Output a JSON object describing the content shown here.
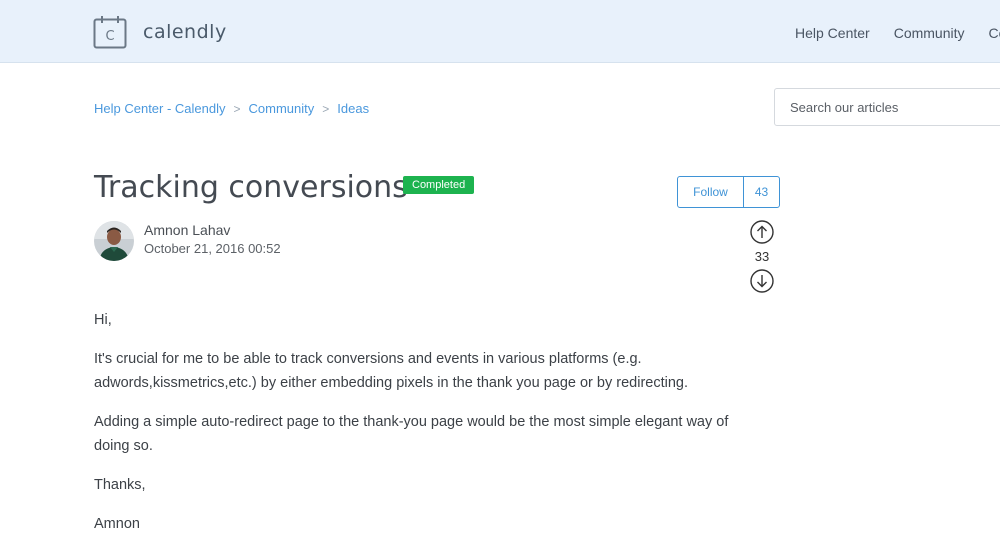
{
  "header": {
    "logo_text": "calendly",
    "logo_glyph": "C",
    "nav": [
      "Help Center",
      "Community",
      "Co"
    ]
  },
  "breadcrumb": {
    "items": [
      "Help Center - Calendly",
      "Community",
      "Ideas"
    ],
    "separator": ">"
  },
  "search": {
    "placeholder": "Search our articles"
  },
  "post": {
    "title": "Tracking conversions",
    "status_badge": "Completed",
    "follow_label": "Follow",
    "follow_count": "43",
    "vote_count": "33",
    "author": {
      "name": "Amnon Lahav",
      "date": "October 21, 2016 00:52"
    },
    "body": [
      "Hi,",
      "It's crucial for me to be able to track conversions and events in various platforms (e.g. adwords,kissmetrics,etc.) by either embedding pixels in the thank you page or by redirecting.",
      "Adding a simple auto-redirect page to the thank-you page would be the most simple elegant way of doing so.",
      "Thanks,",
      "Amnon"
    ]
  },
  "colors": {
    "header_bg": "#e8f1fb",
    "link_blue": "#4a98dd",
    "badge_green": "#1db34f",
    "follow_blue": "#3f93d6"
  },
  "icons": [
    "calendar-logo-icon",
    "arrow-up-circle-icon",
    "arrow-down-circle-icon",
    "avatar-photo"
  ]
}
